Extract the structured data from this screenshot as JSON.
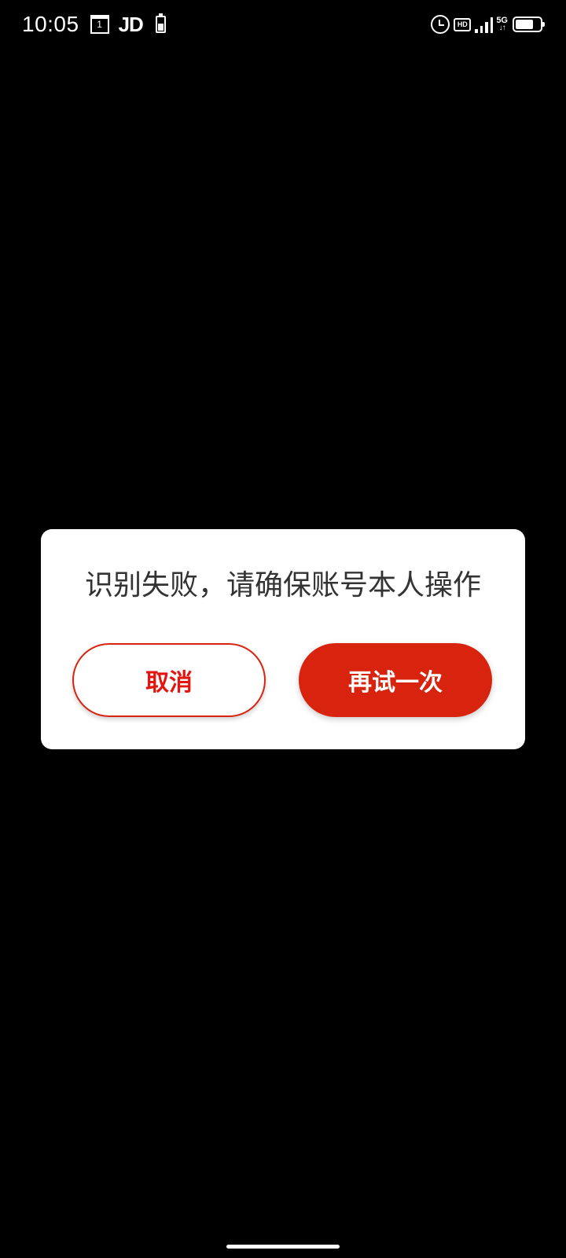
{
  "status_bar": {
    "time": "10:05",
    "calendar_day": "1",
    "jd_label": "JD",
    "hd_label": "HD",
    "network_type": "5G",
    "network_arrows": "↓↑",
    "battery_level": 0.75
  },
  "dialog": {
    "message": "识别失败，请确保账号本人操作",
    "cancel_label": "取消",
    "retry_label": "再试一次"
  },
  "colors": {
    "accent": "#d8230f",
    "cancel_text": "#e3150f",
    "message_text": "#333333",
    "background": "#000000",
    "dialog_background": "#ffffff"
  },
  "icons": {
    "status_left": [
      "calendar-icon",
      "jd-app-icon",
      "battery-saver-icon"
    ],
    "status_right": [
      "alarm-icon",
      "hd-icon",
      "signal-icon",
      "network-5g-icon",
      "battery-icon"
    ]
  }
}
